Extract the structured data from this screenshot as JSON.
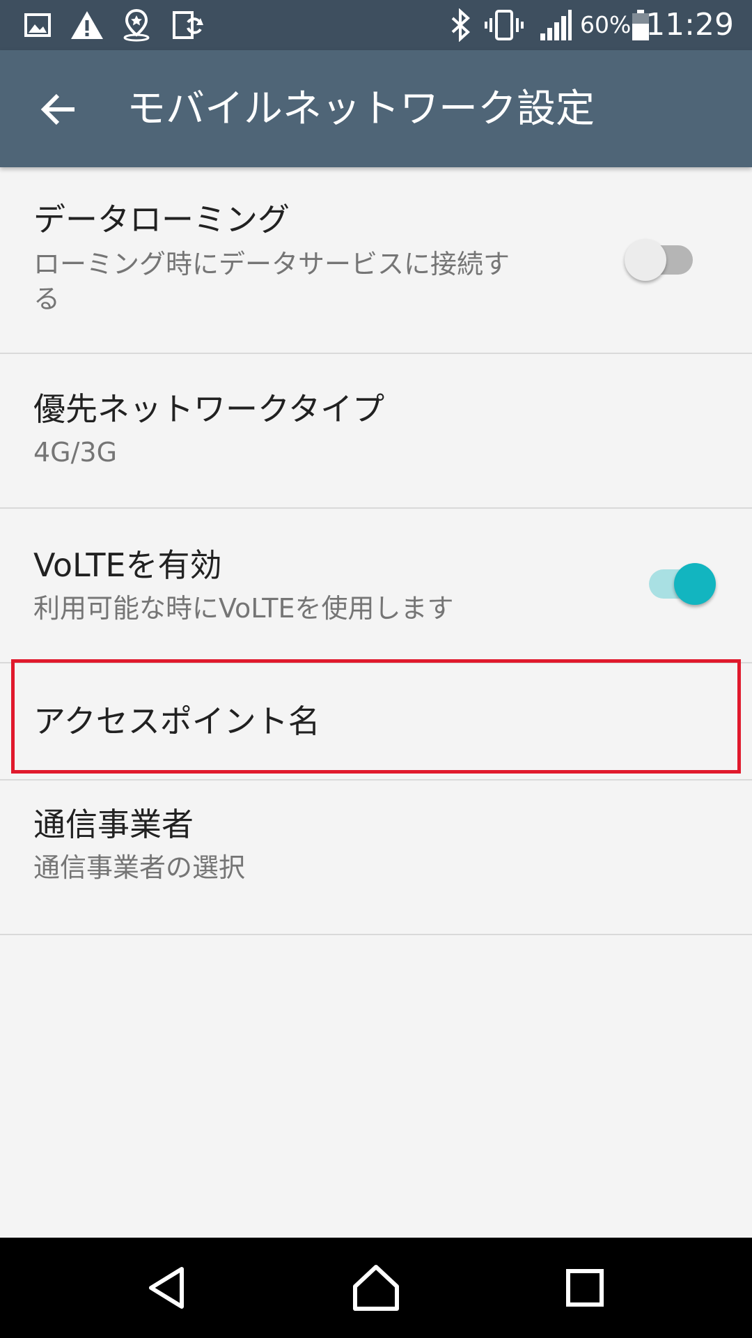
{
  "status_bar": {
    "icons_left": [
      "image-icon",
      "warning-icon",
      "location-pin-icon",
      "screen-sync-icon"
    ],
    "icons_right": [
      "bluetooth-icon",
      "vibrate-icon",
      "signal-icon",
      "battery-icon"
    ],
    "battery_percent": "60%",
    "time": "11:29"
  },
  "app_bar": {
    "title": "モバイルネットワーク設定",
    "back_icon": "arrow-back-icon"
  },
  "settings": [
    {
      "title": "データローミング",
      "subtitle_line1": "ローミング時にデータサービスに接続す",
      "subtitle_line2": "る",
      "toggle_on": false
    },
    {
      "title": "優先ネットワークタイプ",
      "subtitle": "4G/3G"
    },
    {
      "title": "VoLTEを有効",
      "subtitle": "利用可能な時にVoLTEを使用します",
      "toggle_on": true
    },
    {
      "title": "アクセスポイント名"
    },
    {
      "title": "通信事業者",
      "subtitle": "通信事業者の選択"
    }
  ],
  "colors": {
    "status_bar": "#3e4f5f",
    "app_bar": "#4f6577",
    "accent": "#12b5c0",
    "accent_track": "#a9e0e3",
    "highlight": "#e0192c",
    "background": "#f4f4f4"
  },
  "nav_bar": {
    "buttons": [
      "back-triangle-icon",
      "home-icon",
      "recents-square-icon"
    ]
  }
}
